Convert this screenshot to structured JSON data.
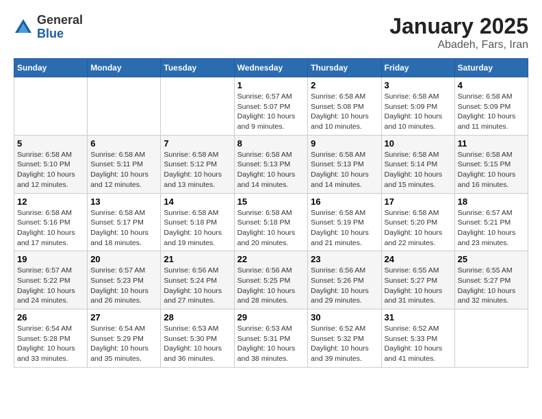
{
  "header": {
    "logo_line1": "General",
    "logo_line2": "Blue",
    "month": "January 2025",
    "location": "Abadeh, Fars, Iran"
  },
  "weekdays": [
    "Sunday",
    "Monday",
    "Tuesday",
    "Wednesday",
    "Thursday",
    "Friday",
    "Saturday"
  ],
  "weeks": [
    [
      {
        "day": "",
        "info": ""
      },
      {
        "day": "",
        "info": ""
      },
      {
        "day": "",
        "info": ""
      },
      {
        "day": "1",
        "info": "Sunrise: 6:57 AM\nSunset: 5:07 PM\nDaylight: 10 hours\nand 9 minutes."
      },
      {
        "day": "2",
        "info": "Sunrise: 6:58 AM\nSunset: 5:08 PM\nDaylight: 10 hours\nand 10 minutes."
      },
      {
        "day": "3",
        "info": "Sunrise: 6:58 AM\nSunset: 5:09 PM\nDaylight: 10 hours\nand 10 minutes."
      },
      {
        "day": "4",
        "info": "Sunrise: 6:58 AM\nSunset: 5:09 PM\nDaylight: 10 hours\nand 11 minutes."
      }
    ],
    [
      {
        "day": "5",
        "info": "Sunrise: 6:58 AM\nSunset: 5:10 PM\nDaylight: 10 hours\nand 12 minutes."
      },
      {
        "day": "6",
        "info": "Sunrise: 6:58 AM\nSunset: 5:11 PM\nDaylight: 10 hours\nand 12 minutes."
      },
      {
        "day": "7",
        "info": "Sunrise: 6:58 AM\nSunset: 5:12 PM\nDaylight: 10 hours\nand 13 minutes."
      },
      {
        "day": "8",
        "info": "Sunrise: 6:58 AM\nSunset: 5:13 PM\nDaylight: 10 hours\nand 14 minutes."
      },
      {
        "day": "9",
        "info": "Sunrise: 6:58 AM\nSunset: 5:13 PM\nDaylight: 10 hours\nand 14 minutes."
      },
      {
        "day": "10",
        "info": "Sunrise: 6:58 AM\nSunset: 5:14 PM\nDaylight: 10 hours\nand 15 minutes."
      },
      {
        "day": "11",
        "info": "Sunrise: 6:58 AM\nSunset: 5:15 PM\nDaylight: 10 hours\nand 16 minutes."
      }
    ],
    [
      {
        "day": "12",
        "info": "Sunrise: 6:58 AM\nSunset: 5:16 PM\nDaylight: 10 hours\nand 17 minutes."
      },
      {
        "day": "13",
        "info": "Sunrise: 6:58 AM\nSunset: 5:17 PM\nDaylight: 10 hours\nand 18 minutes."
      },
      {
        "day": "14",
        "info": "Sunrise: 6:58 AM\nSunset: 5:18 PM\nDaylight: 10 hours\nand 19 minutes."
      },
      {
        "day": "15",
        "info": "Sunrise: 6:58 AM\nSunset: 5:18 PM\nDaylight: 10 hours\nand 20 minutes."
      },
      {
        "day": "16",
        "info": "Sunrise: 6:58 AM\nSunset: 5:19 PM\nDaylight: 10 hours\nand 21 minutes."
      },
      {
        "day": "17",
        "info": "Sunrise: 6:58 AM\nSunset: 5:20 PM\nDaylight: 10 hours\nand 22 minutes."
      },
      {
        "day": "18",
        "info": "Sunrise: 6:57 AM\nSunset: 5:21 PM\nDaylight: 10 hours\nand 23 minutes."
      }
    ],
    [
      {
        "day": "19",
        "info": "Sunrise: 6:57 AM\nSunset: 5:22 PM\nDaylight: 10 hours\nand 24 minutes."
      },
      {
        "day": "20",
        "info": "Sunrise: 6:57 AM\nSunset: 5:23 PM\nDaylight: 10 hours\nand 26 minutes."
      },
      {
        "day": "21",
        "info": "Sunrise: 6:56 AM\nSunset: 5:24 PM\nDaylight: 10 hours\nand 27 minutes."
      },
      {
        "day": "22",
        "info": "Sunrise: 6:56 AM\nSunset: 5:25 PM\nDaylight: 10 hours\nand 28 minutes."
      },
      {
        "day": "23",
        "info": "Sunrise: 6:56 AM\nSunset: 5:26 PM\nDaylight: 10 hours\nand 29 minutes."
      },
      {
        "day": "24",
        "info": "Sunrise: 6:55 AM\nSunset: 5:27 PM\nDaylight: 10 hours\nand 31 minutes."
      },
      {
        "day": "25",
        "info": "Sunrise: 6:55 AM\nSunset: 5:27 PM\nDaylight: 10 hours\nand 32 minutes."
      }
    ],
    [
      {
        "day": "26",
        "info": "Sunrise: 6:54 AM\nSunset: 5:28 PM\nDaylight: 10 hours\nand 33 minutes."
      },
      {
        "day": "27",
        "info": "Sunrise: 6:54 AM\nSunset: 5:29 PM\nDaylight: 10 hours\nand 35 minutes."
      },
      {
        "day": "28",
        "info": "Sunrise: 6:53 AM\nSunset: 5:30 PM\nDaylight: 10 hours\nand 36 minutes."
      },
      {
        "day": "29",
        "info": "Sunrise: 6:53 AM\nSunset: 5:31 PM\nDaylight: 10 hours\nand 38 minutes."
      },
      {
        "day": "30",
        "info": "Sunrise: 6:52 AM\nSunset: 5:32 PM\nDaylight: 10 hours\nand 39 minutes."
      },
      {
        "day": "31",
        "info": "Sunrise: 6:52 AM\nSunset: 5:33 PM\nDaylight: 10 hours\nand 41 minutes."
      },
      {
        "day": "",
        "info": ""
      }
    ]
  ]
}
